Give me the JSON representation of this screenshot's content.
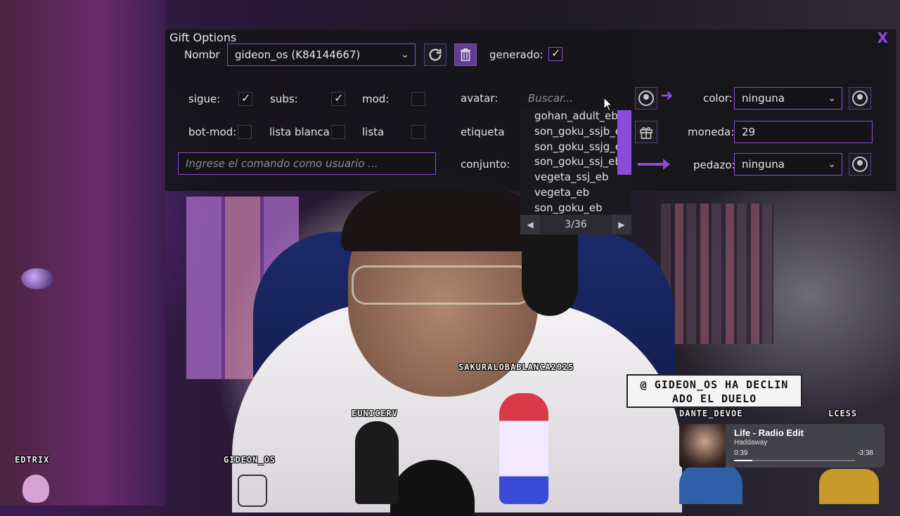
{
  "panel": {
    "title": "Gift Options",
    "close": "X",
    "nombre_label": "Nombr",
    "nombre_value": "gideon_os (K84144667)",
    "generado_label": "generado:",
    "checks": {
      "sigue": "sigue:",
      "subs": "subs:",
      "mod": "mod:",
      "botmod": "bot-mod:",
      "lista_blanca": "lista blanca",
      "lista": "lista"
    },
    "command_placeholder": "Ingrese el comando como usuario ...",
    "avatar_label": "avatar:",
    "avatar_search_placeholder": "Buscar...",
    "etiqueta_label": "etiqueta",
    "conjunto_label": "conjunto:",
    "color_label": "color:",
    "color_value": "ninguna",
    "moneda_label": "moneda:",
    "moneda_value": "29",
    "pedazo_label": "pedazo:",
    "pedazo_value": "ninguna"
  },
  "dropdown": {
    "items": [
      "gohan_adult_eb",
      "son_goku_ssjb_eb",
      "son_goku_ssjg_eb",
      "son_goku_ssj_eb",
      "vegeta_ssj_eb",
      "vegeta_eb",
      "son_goku_eb"
    ],
    "page": "3/36"
  },
  "overlay": {
    "name_top": "SAKURALOBABLANCA2025",
    "name_eunicerv": "EUNICERV",
    "name_gideon": "GIDEON_OS",
    "name_edtrix": "EDTRIX",
    "name_dante": "DANTE_DEVOE",
    "name_lcess": "LCESS",
    "notice": "@ GIDEON_OS HA DECLIN ADO EL DUELO"
  },
  "music": {
    "title": "Life - Radio Edit",
    "artist": "Haddaway",
    "elapsed": "0:39",
    "remaining": "-3:38",
    "progress": 0.15
  },
  "colors": {
    "accent": "#8a4bd8",
    "panel_bg": "#16161a"
  },
  "icons": [
    "refresh-icon",
    "trash-icon",
    "avatar-icon",
    "gift-icon",
    "arrow-right-icon",
    "chevron-down-icon",
    "check-icon"
  ]
}
